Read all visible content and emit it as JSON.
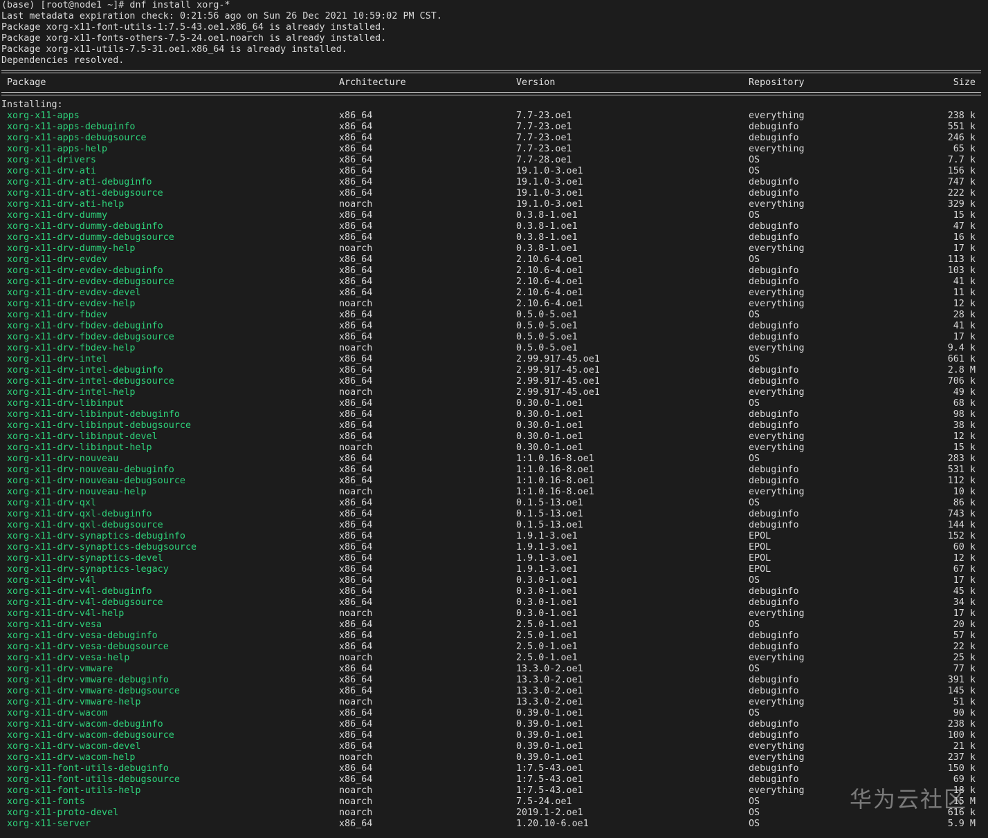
{
  "prompt": "(base) [root@node1 ~]# dnf install xorg-*",
  "output_lines": [
    "Last metadata expiration check: 0:21:56 ago on Sun 26 Dec 2021 10:59:02 PM CST.",
    "Package xorg-x11-font-utils-1:7.5-43.oe1.x86_64 is already installed.",
    "Package xorg-x11-fonts-others-7.5-24.oe1.noarch is already installed.",
    "Package xorg-x11-utils-7.5-31.oe1.x86_64 is already installed.",
    "Dependencies resolved."
  ],
  "table": {
    "headers": {
      "package": "Package",
      "architecture": "Architecture",
      "version": "Version",
      "repository": "Repository",
      "size": "Size"
    },
    "section_label": "Installing:",
    "rows": [
      {
        "pkg": "xorg-x11-apps",
        "arch": "x86_64",
        "ver": "7.7-23.oe1",
        "repo": "everything",
        "size": "238 k"
      },
      {
        "pkg": "xorg-x11-apps-debuginfo",
        "arch": "x86_64",
        "ver": "7.7-23.oe1",
        "repo": "debuginfo",
        "size": "551 k"
      },
      {
        "pkg": "xorg-x11-apps-debugsource",
        "arch": "x86_64",
        "ver": "7.7-23.oe1",
        "repo": "debuginfo",
        "size": "246 k"
      },
      {
        "pkg": "xorg-x11-apps-help",
        "arch": "x86_64",
        "ver": "7.7-23.oe1",
        "repo": "everything",
        "size": "65 k"
      },
      {
        "pkg": "xorg-x11-drivers",
        "arch": "x86_64",
        "ver": "7.7-28.oe1",
        "repo": "OS",
        "size": "7.7 k"
      },
      {
        "pkg": "xorg-x11-drv-ati",
        "arch": "x86_64",
        "ver": "19.1.0-3.oe1",
        "repo": "OS",
        "size": "156 k"
      },
      {
        "pkg": "xorg-x11-drv-ati-debuginfo",
        "arch": "x86_64",
        "ver": "19.1.0-3.oe1",
        "repo": "debuginfo",
        "size": "747 k"
      },
      {
        "pkg": "xorg-x11-drv-ati-debugsource",
        "arch": "x86_64",
        "ver": "19.1.0-3.oe1",
        "repo": "debuginfo",
        "size": "222 k"
      },
      {
        "pkg": "xorg-x11-drv-ati-help",
        "arch": "noarch",
        "ver": "19.1.0-3.oe1",
        "repo": "everything",
        "size": "329 k"
      },
      {
        "pkg": "xorg-x11-drv-dummy",
        "arch": "x86_64",
        "ver": "0.3.8-1.oe1",
        "repo": "OS",
        "size": "15 k"
      },
      {
        "pkg": "xorg-x11-drv-dummy-debuginfo",
        "arch": "x86_64",
        "ver": "0.3.8-1.oe1",
        "repo": "debuginfo",
        "size": "47 k"
      },
      {
        "pkg": "xorg-x11-drv-dummy-debugsource",
        "arch": "x86_64",
        "ver": "0.3.8-1.oe1",
        "repo": "debuginfo",
        "size": "16 k"
      },
      {
        "pkg": "xorg-x11-drv-dummy-help",
        "arch": "noarch",
        "ver": "0.3.8-1.oe1",
        "repo": "everything",
        "size": "17 k"
      },
      {
        "pkg": "xorg-x11-drv-evdev",
        "arch": "x86_64",
        "ver": "2.10.6-4.oe1",
        "repo": "OS",
        "size": "113 k"
      },
      {
        "pkg": "xorg-x11-drv-evdev-debuginfo",
        "arch": "x86_64",
        "ver": "2.10.6-4.oe1",
        "repo": "debuginfo",
        "size": "103 k"
      },
      {
        "pkg": "xorg-x11-drv-evdev-debugsource",
        "arch": "x86_64",
        "ver": "2.10.6-4.oe1",
        "repo": "debuginfo",
        "size": "41 k"
      },
      {
        "pkg": "xorg-x11-drv-evdev-devel",
        "arch": "x86_64",
        "ver": "2.10.6-4.oe1",
        "repo": "everything",
        "size": "11 k"
      },
      {
        "pkg": "xorg-x11-drv-evdev-help",
        "arch": "noarch",
        "ver": "2.10.6-4.oe1",
        "repo": "everything",
        "size": "12 k"
      },
      {
        "pkg": "xorg-x11-drv-fbdev",
        "arch": "x86_64",
        "ver": "0.5.0-5.oe1",
        "repo": "OS",
        "size": "28 k"
      },
      {
        "pkg": "xorg-x11-drv-fbdev-debuginfo",
        "arch": "x86_64",
        "ver": "0.5.0-5.oe1",
        "repo": "debuginfo",
        "size": "41 k"
      },
      {
        "pkg": "xorg-x11-drv-fbdev-debugsource",
        "arch": "x86_64",
        "ver": "0.5.0-5.oe1",
        "repo": "debuginfo",
        "size": "17 k"
      },
      {
        "pkg": "xorg-x11-drv-fbdev-help",
        "arch": "noarch",
        "ver": "0.5.0-5.oe1",
        "repo": "everything",
        "size": "9.4 k"
      },
      {
        "pkg": "xorg-x11-drv-intel",
        "arch": "x86_64",
        "ver": "2.99.917-45.oe1",
        "repo": "OS",
        "size": "661 k"
      },
      {
        "pkg": "xorg-x11-drv-intel-debuginfo",
        "arch": "x86_64",
        "ver": "2.99.917-45.oe1",
        "repo": "debuginfo",
        "size": "2.8 M"
      },
      {
        "pkg": "xorg-x11-drv-intel-debugsource",
        "arch": "x86_64",
        "ver": "2.99.917-45.oe1",
        "repo": "debuginfo",
        "size": "706 k"
      },
      {
        "pkg": "xorg-x11-drv-intel-help",
        "arch": "noarch",
        "ver": "2.99.917-45.oe1",
        "repo": "everything",
        "size": "49 k"
      },
      {
        "pkg": "xorg-x11-drv-libinput",
        "arch": "x86_64",
        "ver": "0.30.0-1.oe1",
        "repo": "OS",
        "size": "68 k"
      },
      {
        "pkg": "xorg-x11-drv-libinput-debuginfo",
        "arch": "x86_64",
        "ver": "0.30.0-1.oe1",
        "repo": "debuginfo",
        "size": "98 k"
      },
      {
        "pkg": "xorg-x11-drv-libinput-debugsource",
        "arch": "x86_64",
        "ver": "0.30.0-1.oe1",
        "repo": "debuginfo",
        "size": "38 k"
      },
      {
        "pkg": "xorg-x11-drv-libinput-devel",
        "arch": "x86_64",
        "ver": "0.30.0-1.oe1",
        "repo": "everything",
        "size": "12 k"
      },
      {
        "pkg": "xorg-x11-drv-libinput-help",
        "arch": "noarch",
        "ver": "0.30.0-1.oe1",
        "repo": "everything",
        "size": "15 k"
      },
      {
        "pkg": "xorg-x11-drv-nouveau",
        "arch": "x86_64",
        "ver": "1:1.0.16-8.oe1",
        "repo": "OS",
        "size": "283 k"
      },
      {
        "pkg": "xorg-x11-drv-nouveau-debuginfo",
        "arch": "x86_64",
        "ver": "1:1.0.16-8.oe1",
        "repo": "debuginfo",
        "size": "531 k"
      },
      {
        "pkg": "xorg-x11-drv-nouveau-debugsource",
        "arch": "x86_64",
        "ver": "1:1.0.16-8.oe1",
        "repo": "debuginfo",
        "size": "112 k"
      },
      {
        "pkg": "xorg-x11-drv-nouveau-help",
        "arch": "noarch",
        "ver": "1:1.0.16-8.oe1",
        "repo": "everything",
        "size": "10 k"
      },
      {
        "pkg": "xorg-x11-drv-qxl",
        "arch": "x86_64",
        "ver": "0.1.5-13.oe1",
        "repo": "OS",
        "size": "86 k"
      },
      {
        "pkg": "xorg-x11-drv-qxl-debuginfo",
        "arch": "x86_64",
        "ver": "0.1.5-13.oe1",
        "repo": "debuginfo",
        "size": "743 k"
      },
      {
        "pkg": "xorg-x11-drv-qxl-debugsource",
        "arch": "x86_64",
        "ver": "0.1.5-13.oe1",
        "repo": "debuginfo",
        "size": "144 k"
      },
      {
        "pkg": "xorg-x11-drv-synaptics-debuginfo",
        "arch": "x86_64",
        "ver": "1.9.1-3.oe1",
        "repo": "EPOL",
        "size": "152 k"
      },
      {
        "pkg": "xorg-x11-drv-synaptics-debugsource",
        "arch": "x86_64",
        "ver": "1.9.1-3.oe1",
        "repo": "EPOL",
        "size": "60 k"
      },
      {
        "pkg": "xorg-x11-drv-synaptics-devel",
        "arch": "x86_64",
        "ver": "1.9.1-3.oe1",
        "repo": "EPOL",
        "size": "12 k"
      },
      {
        "pkg": "xorg-x11-drv-synaptics-legacy",
        "arch": "x86_64",
        "ver": "1.9.1-3.oe1",
        "repo": "EPOL",
        "size": "67 k"
      },
      {
        "pkg": "xorg-x11-drv-v4l",
        "arch": "x86_64",
        "ver": "0.3.0-1.oe1",
        "repo": "OS",
        "size": "17 k"
      },
      {
        "pkg": "xorg-x11-drv-v4l-debuginfo",
        "arch": "x86_64",
        "ver": "0.3.0-1.oe1",
        "repo": "debuginfo",
        "size": "45 k"
      },
      {
        "pkg": "xorg-x11-drv-v4l-debugsource",
        "arch": "x86_64",
        "ver": "0.3.0-1.oe1",
        "repo": "debuginfo",
        "size": "34 k"
      },
      {
        "pkg": "xorg-x11-drv-v4l-help",
        "arch": "noarch",
        "ver": "0.3.0-1.oe1",
        "repo": "everything",
        "size": "17 k"
      },
      {
        "pkg": "xorg-x11-drv-vesa",
        "arch": "x86_64",
        "ver": "2.5.0-1.oe1",
        "repo": "OS",
        "size": "20 k"
      },
      {
        "pkg": "xorg-x11-drv-vesa-debuginfo",
        "arch": "x86_64",
        "ver": "2.5.0-1.oe1",
        "repo": "debuginfo",
        "size": "57 k"
      },
      {
        "pkg": "xorg-x11-drv-vesa-debugsource",
        "arch": "x86_64",
        "ver": "2.5.0-1.oe1",
        "repo": "debuginfo",
        "size": "22 k"
      },
      {
        "pkg": "xorg-x11-drv-vesa-help",
        "arch": "noarch",
        "ver": "2.5.0-1.oe1",
        "repo": "everything",
        "size": "25 k"
      },
      {
        "pkg": "xorg-x11-drv-vmware",
        "arch": "x86_64",
        "ver": "13.3.0-2.oe1",
        "repo": "OS",
        "size": "77 k"
      },
      {
        "pkg": "xorg-x11-drv-vmware-debuginfo",
        "arch": "x86_64",
        "ver": "13.3.0-2.oe1",
        "repo": "debuginfo",
        "size": "391 k"
      },
      {
        "pkg": "xorg-x11-drv-vmware-debugsource",
        "arch": "x86_64",
        "ver": "13.3.0-2.oe1",
        "repo": "debuginfo",
        "size": "145 k"
      },
      {
        "pkg": "xorg-x11-drv-vmware-help",
        "arch": "noarch",
        "ver": "13.3.0-2.oe1",
        "repo": "everything",
        "size": "51 k"
      },
      {
        "pkg": "xorg-x11-drv-wacom",
        "arch": "x86_64",
        "ver": "0.39.0-1.oe1",
        "repo": "OS",
        "size": "90 k"
      },
      {
        "pkg": "xorg-x11-drv-wacom-debuginfo",
        "arch": "x86_64",
        "ver": "0.39.0-1.oe1",
        "repo": "debuginfo",
        "size": "238 k"
      },
      {
        "pkg": "xorg-x11-drv-wacom-debugsource",
        "arch": "x86_64",
        "ver": "0.39.0-1.oe1",
        "repo": "debuginfo",
        "size": "100 k"
      },
      {
        "pkg": "xorg-x11-drv-wacom-devel",
        "arch": "x86_64",
        "ver": "0.39.0-1.oe1",
        "repo": "everything",
        "size": "21 k"
      },
      {
        "pkg": "xorg-x11-drv-wacom-help",
        "arch": "noarch",
        "ver": "0.39.0-1.oe1",
        "repo": "everything",
        "size": "237 k"
      },
      {
        "pkg": "xorg-x11-font-utils-debuginfo",
        "arch": "x86_64",
        "ver": "1:7.5-43.oe1",
        "repo": "debuginfo",
        "size": "150 k"
      },
      {
        "pkg": "xorg-x11-font-utils-debugsource",
        "arch": "x86_64",
        "ver": "1:7.5-43.oe1",
        "repo": "debuginfo",
        "size": "69 k"
      },
      {
        "pkg": "xorg-x11-font-utils-help",
        "arch": "noarch",
        "ver": "1:7.5-43.oe1",
        "repo": "everything",
        "size": "18 k"
      },
      {
        "pkg": "xorg-x11-fonts",
        "arch": "noarch",
        "ver": "7.5-24.oe1",
        "repo": "OS",
        "size": "15 M"
      },
      {
        "pkg": "xorg-x11-proto-devel",
        "arch": "noarch",
        "ver": "2019.1-2.oe1",
        "repo": "OS",
        "size": "616 k"
      },
      {
        "pkg": "xorg-x11-server",
        "arch": "x86_64",
        "ver": "1.20.10-6.oe1",
        "repo": "OS",
        "size": "5.9 M"
      }
    ]
  },
  "watermark": "华为云社区",
  "colors": {
    "background": "#1c1c1c",
    "text": "#d8d8d8",
    "package_name": "#2ed17a"
  }
}
